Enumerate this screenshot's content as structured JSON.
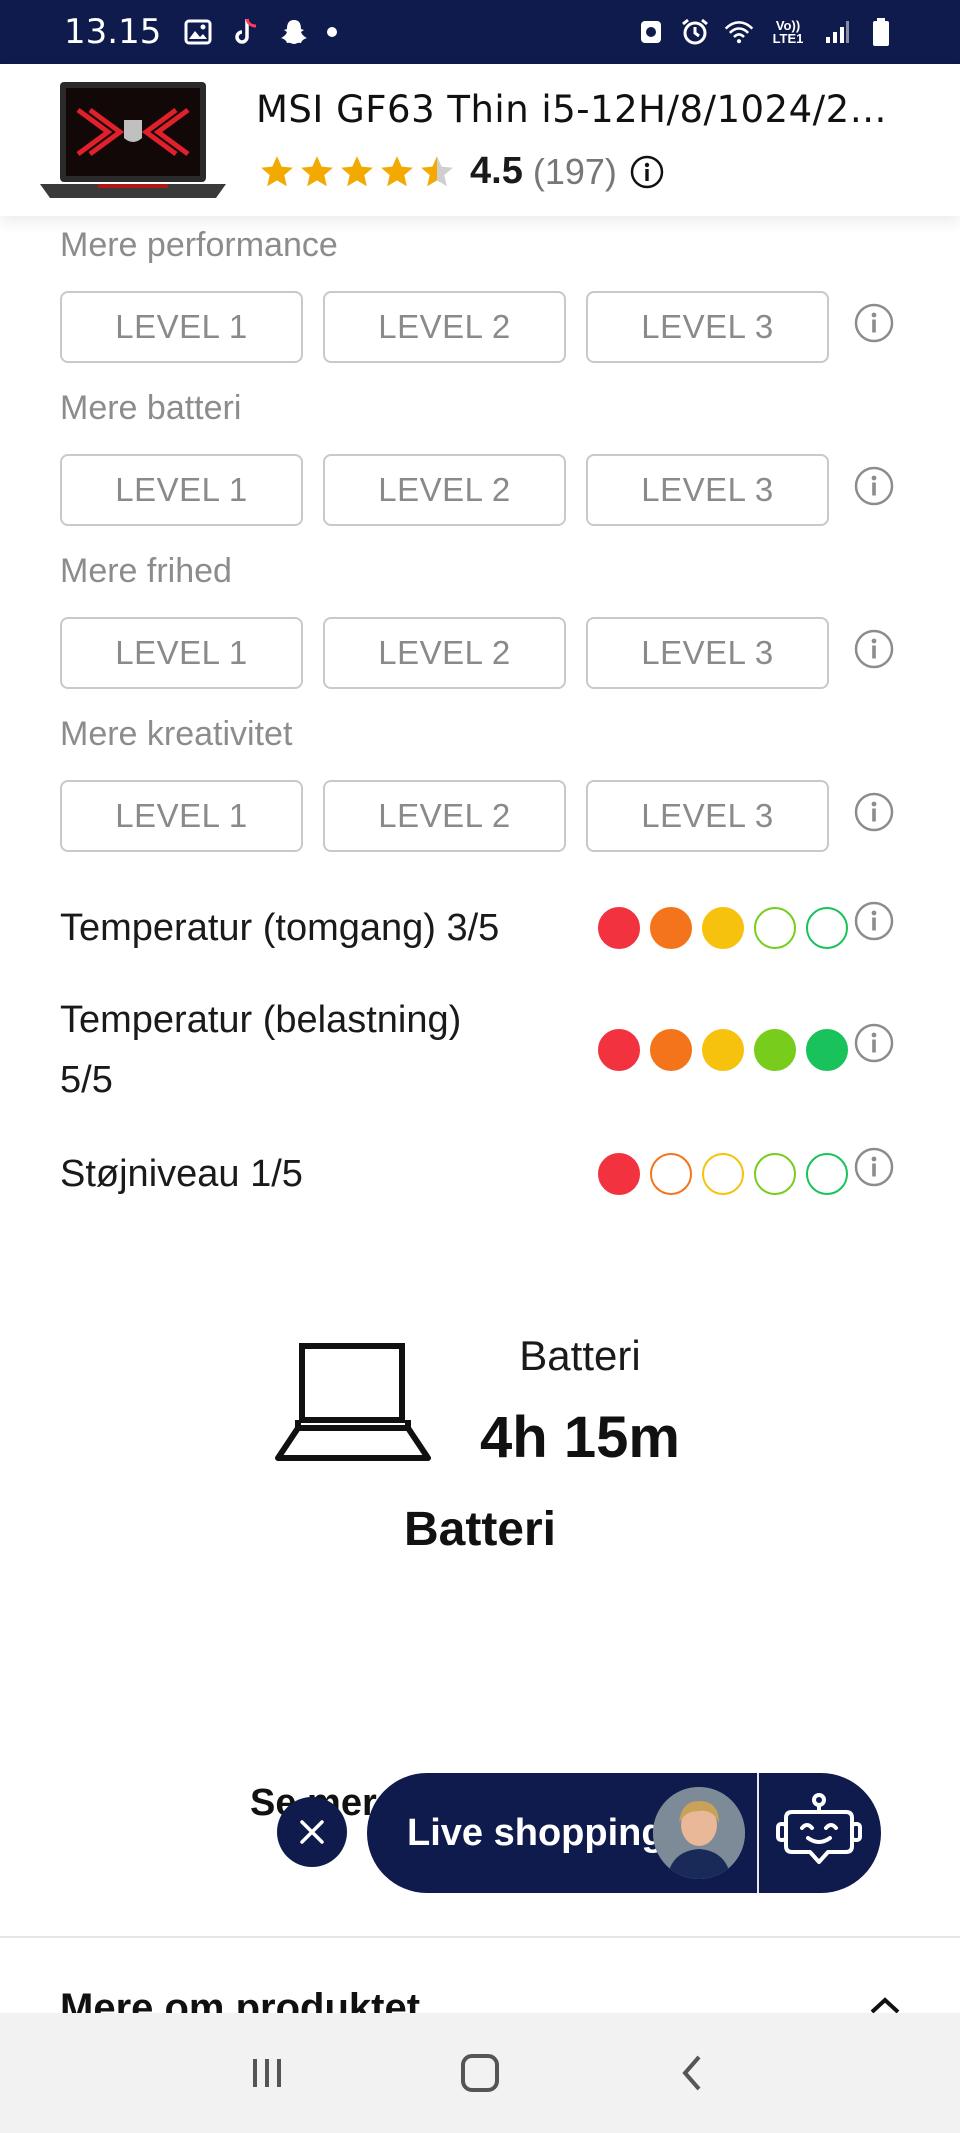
{
  "status_bar": {
    "time": "13.15",
    "icons_left": [
      "gallery-icon",
      "tiktok-icon",
      "snapchat-icon",
      "notification-dot"
    ],
    "icons_right": [
      "nfc-icon",
      "alarm-icon",
      "wifi-icon",
      "volte-icon",
      "signal-icon",
      "battery-icon"
    ],
    "volte_text": "Vo)) LTE1"
  },
  "product": {
    "title": "MSI GF63 Thin i5-12H/8/1024/2050...",
    "rating": "4.5",
    "reviews": "(197)",
    "stars_value": 4.5
  },
  "groups": [
    {
      "label": "Mere performance",
      "levels": [
        "LEVEL 1",
        "LEVEL 2",
        "LEVEL 3"
      ]
    },
    {
      "label": "Mere batteri",
      "levels": [
        "LEVEL 1",
        "LEVEL 2",
        "LEVEL 3"
      ]
    },
    {
      "label": "Mere frihed",
      "levels": [
        "LEVEL 1",
        "LEVEL 2",
        "LEVEL 3"
      ]
    },
    {
      "label": "Mere kreativitet",
      "levels": [
        "LEVEL 1",
        "LEVEL 2",
        "LEVEL 3"
      ]
    }
  ],
  "metrics": [
    {
      "label": "Temperatur (tomgang) 3/5",
      "score": 3,
      "max": 5
    },
    {
      "label": "Temperatur (belastning) 5/5",
      "label_line1": "Temperatur (belastning)",
      "label_line2": "5/5",
      "score": 5,
      "max": 5
    },
    {
      "label": "Støjniveau 1/5",
      "score": 1,
      "max": 5
    }
  ],
  "dot_colors": [
    "#f2323f",
    "#f4741c",
    "#f6c20e",
    "#78cc1c",
    "#19c25a"
  ],
  "battery": {
    "label": "Batteri",
    "value": "4h 15m",
    "section_title": "Batteri"
  },
  "floating": {
    "partial_text": "Se mer",
    "live_label": "Live shopping"
  },
  "more_section": {
    "title": "Mere om produktet"
  },
  "colors": {
    "brand_navy": "#0f1b4d",
    "star_gold": "#f2a900"
  }
}
